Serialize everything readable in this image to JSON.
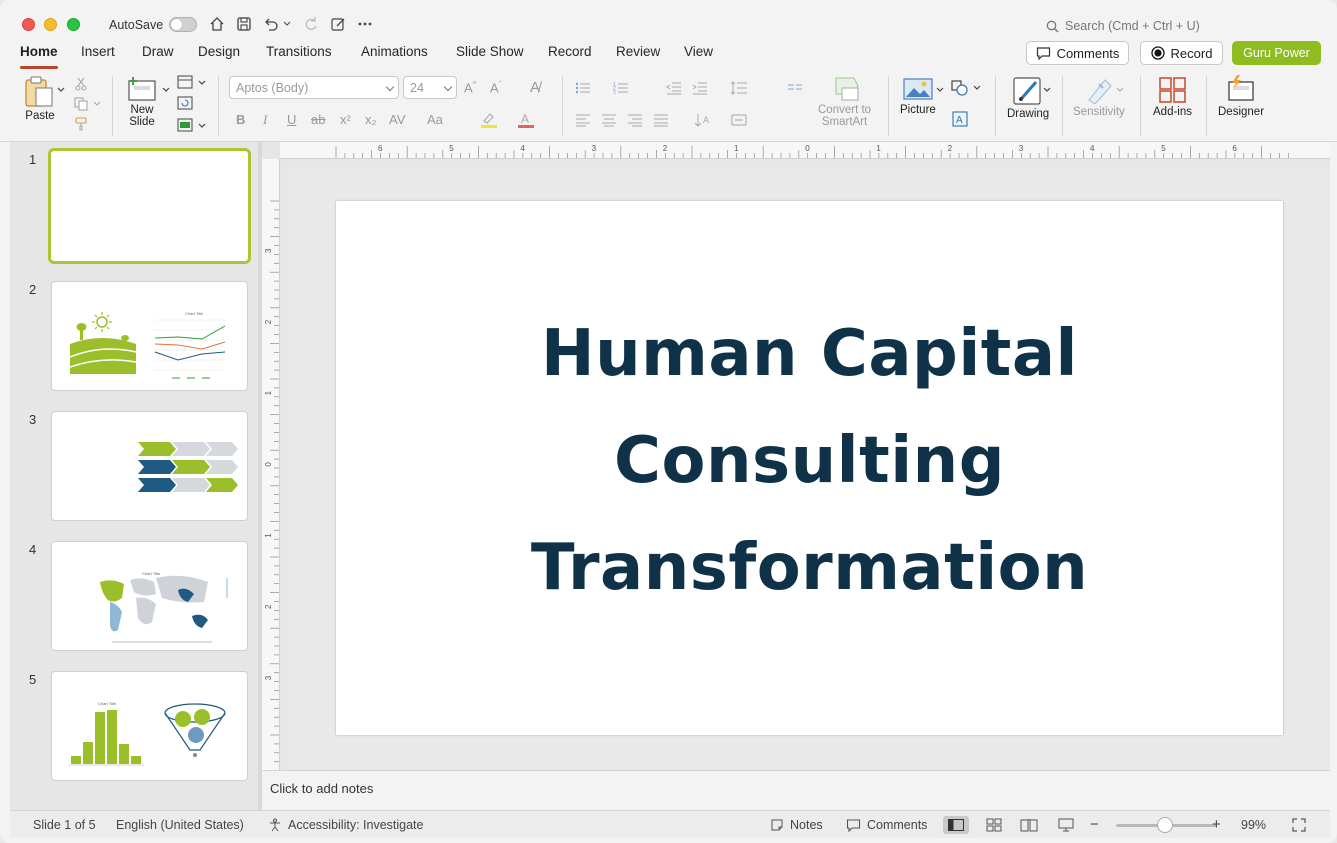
{
  "titlebar": {
    "autosave_label": "AutoSave",
    "search_placeholder": "Search (Cmd + Ctrl + U)"
  },
  "tabs": [
    {
      "label": "Home",
      "active": true
    },
    {
      "label": "Insert"
    },
    {
      "label": "Draw"
    },
    {
      "label": "Design"
    },
    {
      "label": "Transitions"
    },
    {
      "label": "Animations"
    },
    {
      "label": "Slide Show"
    },
    {
      "label": "Record"
    },
    {
      "label": "Review"
    },
    {
      "label": "View"
    }
  ],
  "header_buttons": {
    "comments": "Comments",
    "record": "Record",
    "guru": "Guru Power"
  },
  "ribbon": {
    "paste": "Paste",
    "new_slide_1": "New",
    "new_slide_2": "Slide",
    "font_name": "Aptos (Body)",
    "font_size": "24",
    "convert_1": "Convert to",
    "convert_2": "SmartArt",
    "picture": "Picture",
    "drawing": "Drawing",
    "sensitivity": "Sensitivity",
    "addins": "Add-ins",
    "designer": "Designer"
  },
  "slides": [
    {
      "number": "1",
      "selected": true
    },
    {
      "number": "2",
      "chart_title": "Chart Title"
    },
    {
      "number": "3"
    },
    {
      "number": "4",
      "chart_title": "Chart Title"
    },
    {
      "number": "5",
      "chart_title": "Chart Title"
    }
  ],
  "slide": {
    "title_line1": "Human Capital",
    "title_line2": "Consulting",
    "title_line3": "Transformation"
  },
  "notes_placeholder": "Click to add notes",
  "status": {
    "slide_info": "Slide 1 of 5",
    "language": "English (United States)",
    "accessibility": "Accessibility: Investigate",
    "notes": "Notes",
    "comments": "Comments",
    "zoom": "99%"
  },
  "ruler": {
    "h_labels": [
      "6",
      "5",
      "4",
      "3",
      "2",
      "1",
      "0",
      "1",
      "2",
      "3",
      "4",
      "5",
      "6"
    ],
    "v_labels": [
      "3",
      "2",
      "1",
      "0",
      "1",
      "2",
      "3"
    ]
  },
  "colors": {
    "accent_tab": "#b7472a",
    "guru_green": "#8fbc1f",
    "title_navy": "#0f3249",
    "selection_green": "#b0c433"
  }
}
